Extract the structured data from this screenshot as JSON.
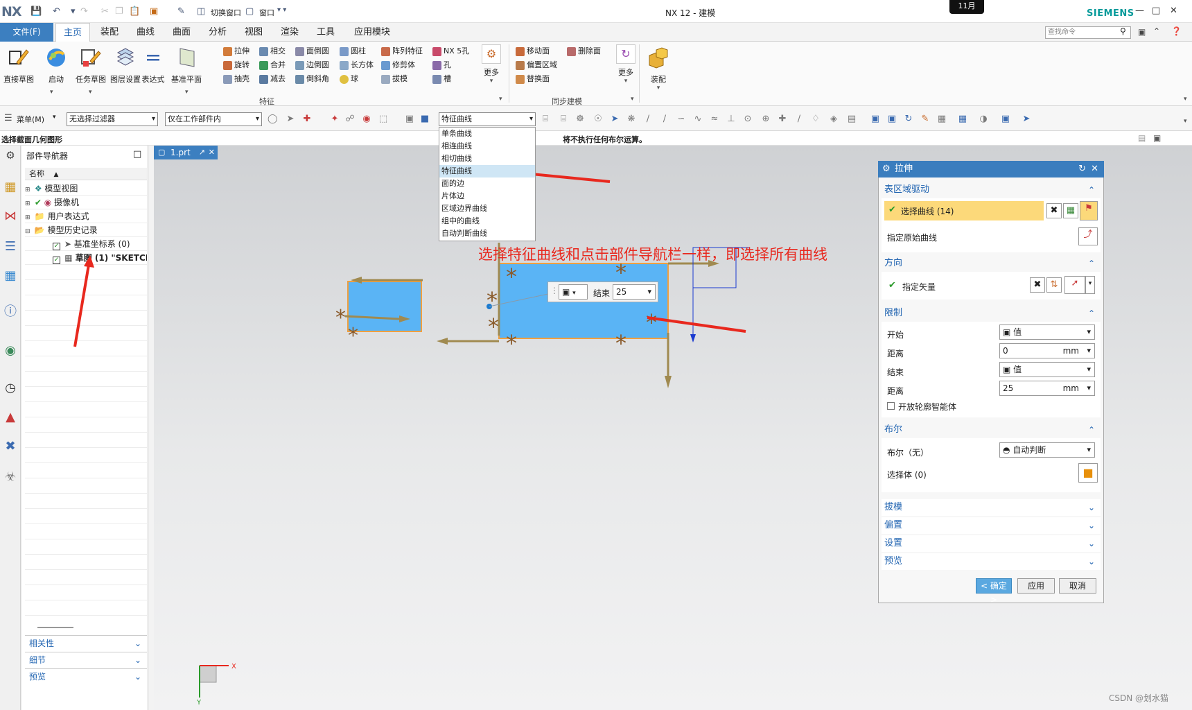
{
  "app": {
    "logo": "NX",
    "title": "NX 12 - 建模",
    "brand": "SIEMENS",
    "date_badge": "11月"
  },
  "quick_access": {
    "switch_window": "切换窗口",
    "window": "窗口"
  },
  "tabs": {
    "file": "文件(F)",
    "items": [
      "主页",
      "装配",
      "曲线",
      "曲面",
      "分析",
      "视图",
      "渲染",
      "工具",
      "应用模块"
    ],
    "active": "主页"
  },
  "search": {
    "placeholder": "查找命令"
  },
  "ribbon": {
    "big": [
      "直接草图",
      "启动",
      "任务草图",
      "图层设置",
      "表达式",
      "基准平面"
    ],
    "feature_col1": [
      "拉伸",
      "旋转",
      "抽壳"
    ],
    "feature_col2": [
      "相交",
      "合并",
      "减去"
    ],
    "feature_col3": [
      "面倒圆",
      "边倒圆",
      "倒斜角"
    ],
    "feature_col4": [
      "圆柱",
      "长方体",
      "球"
    ],
    "feature_col5": [
      "阵列特征",
      "修剪体",
      "拔模"
    ],
    "feature_col6": [
      "NX 5孔",
      "孔",
      "槽"
    ],
    "more": "更多",
    "sync_col1": [
      "移动面",
      "偏置区域",
      "替换面"
    ],
    "sync_col2": [
      "删除面"
    ],
    "assembly": "装配",
    "group_feature": "特征",
    "group_sync": "同步建模"
  },
  "toolbar2": {
    "menu": "菜单(M)",
    "filter": "无选择过滤器",
    "scope": "仅在工作部件内",
    "curve_rule": "特征曲线"
  },
  "status": {
    "prompt": "选择截面几何图形",
    "message": "将不执行任何布尔运算。"
  },
  "navigator": {
    "title": "部件导航器",
    "column": "名称",
    "items": [
      {
        "label": "模型视图",
        "toggle": "+",
        "check": false
      },
      {
        "label": "摄像机",
        "toggle": "+",
        "check": true
      },
      {
        "label": "用户表达式",
        "toggle": "+",
        "check": false
      },
      {
        "label": "模型历史记录",
        "toggle": "-",
        "check": false
      },
      {
        "label": "基准坐标系 (0)",
        "toggle": "",
        "check": true
      },
      {
        "label": "草图 (1) \"SKETCH",
        "toggle": "",
        "check": true
      }
    ],
    "sections": [
      "相关性",
      "细节",
      "预览"
    ]
  },
  "document_tab": "1.prt",
  "curve_rule_dropdown": {
    "options": [
      "单条曲线",
      "相连曲线",
      "相切曲线",
      "特征曲线",
      "面的边",
      "片体边",
      "区域边界曲线",
      "组中的曲线",
      "自动判断曲线"
    ],
    "selected": "特征曲线"
  },
  "annotation": "选择特征曲线和点击部件导航栏一样，即选择所有曲线",
  "inline_input": {
    "label": "结束",
    "value": "25"
  },
  "extrude_dialog": {
    "title": "拉伸",
    "sections": {
      "section": {
        "title": "表区域驱动",
        "select_curve": "选择曲线 (14)",
        "specify_origin": "指定原始曲线"
      },
      "direction": {
        "title": "方向",
        "specify_vector": "指定矢量"
      },
      "limits": {
        "title": "限制",
        "start_label": "开始",
        "start_value": "值",
        "distance1_label": "距离",
        "distance1_value": "0",
        "unit1": "mm",
        "end_label": "结束",
        "end_value": "值",
        "distance2_label": "距离",
        "distance2_value": "25",
        "unit2": "mm",
        "open_profile": "开放轮廓智能体"
      },
      "boolean": {
        "title": "布尔",
        "boolean_label": "布尔（无）",
        "boolean_value": "自动判断",
        "select_body": "选择体 (0)"
      },
      "collapsed": [
        "拔模",
        "偏置",
        "设置",
        "预览"
      ]
    },
    "buttons": {
      "ok": "< 确定 >",
      "apply": "应用",
      "cancel": "取消"
    }
  },
  "triad": {
    "x": "X",
    "y": "Y"
  },
  "watermark": "CSDN @划水猫",
  "colors": {
    "accent": "#3c7fc0",
    "annotation": "#e8281e",
    "sketch_fill": "#5ab4f5",
    "sketch_orange": "#f0a040"
  }
}
